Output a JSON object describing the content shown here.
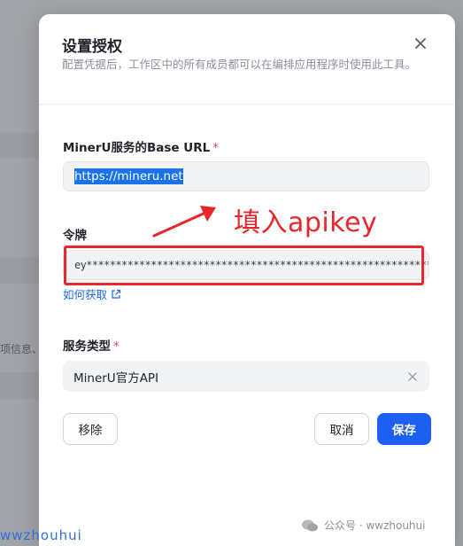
{
  "dialog": {
    "title": "设置授权",
    "description": "配置凭据后，工作区中的所有成员都可以在编排应用程序时使用此工具。"
  },
  "base_url": {
    "label": "MinerU服务的Base URL",
    "required_mark": "*",
    "value": "https://mineru.net"
  },
  "token": {
    "label": "令牌",
    "value": "ey*************************************************************",
    "help_link": "如何获取"
  },
  "service_type": {
    "label": "服务类型",
    "required_mark": "*",
    "selected": "MinerU官方API"
  },
  "buttons": {
    "remove": "移除",
    "cancel": "取消",
    "save": "保存"
  },
  "annotation": {
    "text": "填入apikey",
    "color": "#e8262b"
  },
  "background": {
    "partial_text": "项信息、"
  },
  "watermark": {
    "left": "wwzhouhui",
    "right": "公众号 · wwzhouhui"
  },
  "colors": {
    "primary": "#1d5ff0",
    "required": "#e5484d",
    "link": "#1d6ae5"
  }
}
